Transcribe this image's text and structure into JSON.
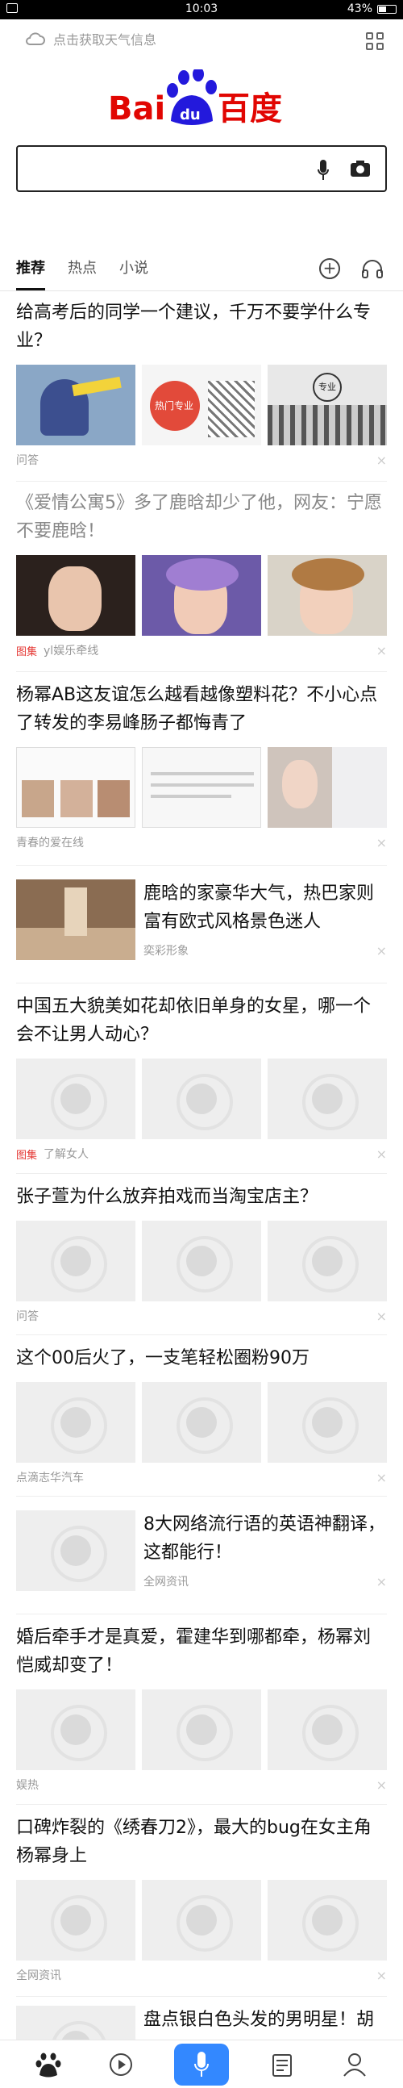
{
  "status": {
    "time": "10:03",
    "battery": "43%"
  },
  "weather": {
    "text": "点击获取天气信息",
    "icon": "cloud-icon"
  },
  "logo": {
    "bai": "Bai",
    "du": "du",
    "cn": "百度",
    "color_red": "#e10602",
    "color_blue": "#2319dc"
  },
  "search": {
    "placeholder": ""
  },
  "tabs": [
    {
      "label": "推荐",
      "active": true
    },
    {
      "label": "热点"
    },
    {
      "label": "小说"
    }
  ],
  "articles": [
    {
      "title": "给高考后的同学一个建议，千万不要学什么专业？",
      "source": "问答"
    },
    {
      "title": "《爱情公寓5》多了鹿晗却少了他，网友：宁愿不要鹿晗！",
      "tag": "图集",
      "source": "yl娱乐牵线",
      "read": true
    },
    {
      "title": "杨幂AB这友谊怎么越看越像塑料花？不小心点了转发的李易峰肠子都悔青了",
      "source": "青春的爱在线"
    },
    {
      "title": "鹿晗的家豪华大气，热巴家则富有欧式风格景色迷人",
      "source": "奕彩形象"
    },
    {
      "title": "中国五大貌美如花却依旧单身的女星，哪一个会不让男人动心？",
      "tag": "图集",
      "source": "了解女人"
    },
    {
      "title": "张子萱为什么放弃拍戏而当淘宝店主？",
      "source": "问答"
    },
    {
      "title": "这个00后火了，一支笔轻松圈粉90万",
      "source": "点滴志华汽车"
    },
    {
      "title": "8大网络流行语的英语神翻译，这都能行！",
      "source": "全网资讯"
    },
    {
      "title": "婚后牵手才是真爱，霍建华到哪都牵，杨幂刘恺威却变了！",
      "source": "娱热"
    },
    {
      "title": "口碑炸裂的《绣春刀2》，最大的bug在女主角杨幂身上",
      "source": "全网资讯"
    },
    {
      "title": "盘点银白色头发的男明星！胡"
    }
  ],
  "img_text": {
    "hot_major": "热门专业",
    "major": "专业"
  },
  "close": "×",
  "colors": {
    "accent": "#3388ff",
    "tag": "#e53935"
  }
}
